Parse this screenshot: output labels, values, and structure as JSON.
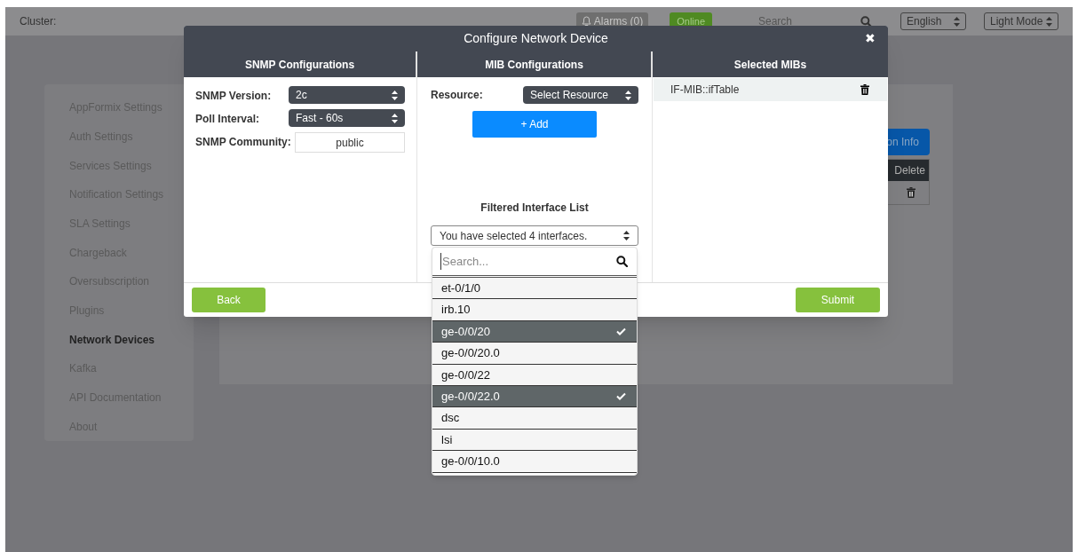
{
  "header": {
    "cluster_label": "Cluster:",
    "alarms": "Alarms (0)",
    "status": "Online",
    "search_placeholder": "Search",
    "language": "English",
    "theme": "Light Mode"
  },
  "sidebar": {
    "items": [
      {
        "label": "AppFormix Settings",
        "selected": false
      },
      {
        "label": "Auth Settings",
        "selected": false
      },
      {
        "label": "Services Settings",
        "selected": false
      },
      {
        "label": "Notification Settings",
        "selected": false
      },
      {
        "label": "SLA Settings",
        "selected": false
      },
      {
        "label": "Chargeback",
        "selected": false
      },
      {
        "label": "Oversubscription",
        "selected": false
      },
      {
        "label": "Plugins",
        "selected": false
      },
      {
        "label": "Network Devices",
        "selected": true
      },
      {
        "label": "Kafka",
        "selected": false
      },
      {
        "label": "API Documentation",
        "selected": false
      },
      {
        "label": "About",
        "selected": false
      }
    ]
  },
  "content": {
    "button": "on Info",
    "table_header": "Delete"
  },
  "modal": {
    "title": "Configure Network Device",
    "close": "✖",
    "columns": [
      "SNMP Configurations",
      "MIB Configurations",
      "Selected MIBs"
    ],
    "snmp_fields": [
      {
        "label": "SNMP Version:",
        "kind": "select",
        "value": "2c"
      },
      {
        "label": "Poll Interval:",
        "kind": "select",
        "value": "Fast - 60s"
      },
      {
        "label": "SNMP Community:",
        "kind": "text",
        "value": "public"
      }
    ],
    "mib": {
      "resource_label": "Resource:",
      "resource_value": "Select Resource",
      "add_button": "+ Add",
      "filtered_title": "Filtered Interface List",
      "filtered_value": "You have selected 4 interfaces.",
      "search_placeholder": "Search...",
      "interfaces": [
        {
          "label": "et-0/1/0",
          "selected": false
        },
        {
          "label": "irb.10",
          "selected": false
        },
        {
          "label": "ge-0/0/20",
          "selected": true
        },
        {
          "label": "ge-0/0/20.0",
          "selected": false
        },
        {
          "label": "ge-0/0/22",
          "selected": false
        },
        {
          "label": "ge-0/0/22.0",
          "selected": true
        },
        {
          "label": "dsc",
          "selected": false
        },
        {
          "label": "lsi",
          "selected": false
        },
        {
          "label": "ge-0/0/10.0",
          "selected": false
        }
      ]
    },
    "selected_mibs": [
      {
        "name": "IF-MIB::ifTable"
      }
    ],
    "back": "Back",
    "submit": "Submit"
  }
}
